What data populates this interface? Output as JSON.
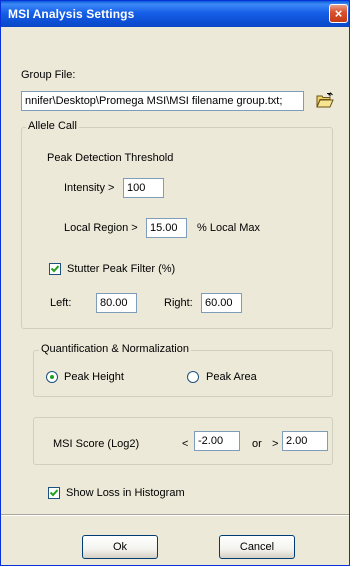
{
  "window": {
    "title": "MSI Analysis Settings",
    "close_glyph": "×"
  },
  "group_file": {
    "label": "Group File:",
    "value": "nnifer\\Desktop\\Promega MSI\\MSI filename group.txt;",
    "browse_icon": "open-folder-icon"
  },
  "allele_call": {
    "legend": "Allele Call",
    "peak_detection_label": "Peak Detection Threshold",
    "intensity_label": "Intensity >",
    "intensity_value": "100",
    "local_region_label": "Local Region >",
    "local_region_value": "15.00",
    "local_max_label": "% Local Max",
    "stutter_label": "Stutter Peak Filter (%)",
    "stutter_checked": true,
    "left_label": "Left:",
    "left_value": "80.00",
    "right_label": "Right:",
    "right_value": "60.00"
  },
  "quantification": {
    "legend": "Quantification & Normalization",
    "peak_height_label": "Peak Height",
    "peak_height_selected": true,
    "peak_area_label": "Peak Area",
    "peak_area_selected": false
  },
  "msi_score": {
    "label": "MSI Score (Log2)",
    "lt_symbol": "<",
    "low_value": "-2.00",
    "or_label": "or",
    "gt_symbol": ">",
    "high_value": "2.00"
  },
  "show_loss": {
    "label": "Show Loss in Histogram",
    "checked": true
  },
  "buttons": {
    "ok": "Ok",
    "cancel": "Cancel"
  },
  "colors": {
    "titlebar": "#0b4cd0",
    "dialog_bg": "#ece9d8",
    "close_button": "#d9532e",
    "radio_dot": "#21a121"
  }
}
